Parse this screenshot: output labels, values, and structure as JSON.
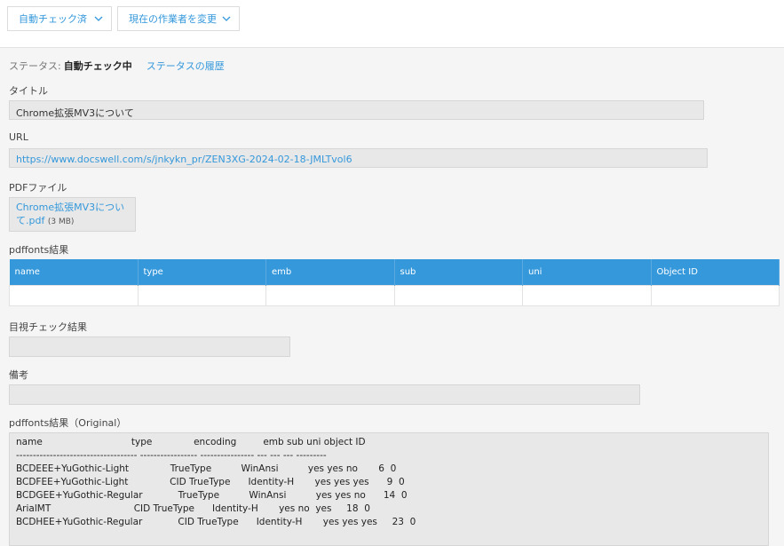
{
  "toolbar": {
    "check_button": "自動チェック済",
    "assignee_button": "現在の作業者を変更"
  },
  "status": {
    "label": "ステータス:",
    "value": "自動チェック中",
    "history_link": "ステータスの履歴"
  },
  "fields": {
    "title_label": "タイトル",
    "title_value": "Chrome拡張MV3について",
    "url_label": "URL",
    "url_value": "https://www.docswell.com/s/jnkykn_pr/ZEN3XG-2024-02-18-JMLTvol6",
    "pdf_label": "PDFファイル",
    "pdf_name_line1": "Chrome拡張MV3につい",
    "pdf_name_line2": "て.pdf",
    "pdf_size": "(3 MB)",
    "pdffonts_label": "pdffonts結果",
    "visual_label": "目視チェック結果",
    "notes_label": "備考",
    "original_label": "pdffonts結果（Original）"
  },
  "fonts_table": {
    "headers": [
      "name",
      "type",
      "emb",
      "sub",
      "uni",
      "Object ID"
    ]
  },
  "original_output": "name                              type              encoding         emb sub uni object ID\n------------------------------------ ----------------- ---------------- --- --- --- ---------\nBCDEEE+YuGothic-Light              TrueType          WinAnsi          yes yes no       6  0\nBCDFEE+YuGothic-Light              CID TrueType      Identity-H       yes yes yes      9  0\nBCDGEE+YuGothic-Regular            TrueType          WinAnsi          yes yes no      14  0\nArialMT                            CID TrueType      Identity-H       yes no  yes     18  0\nBCDHEE+YuGothic-Regular            CID TrueType      Identity-H       yes yes yes     23  0"
}
